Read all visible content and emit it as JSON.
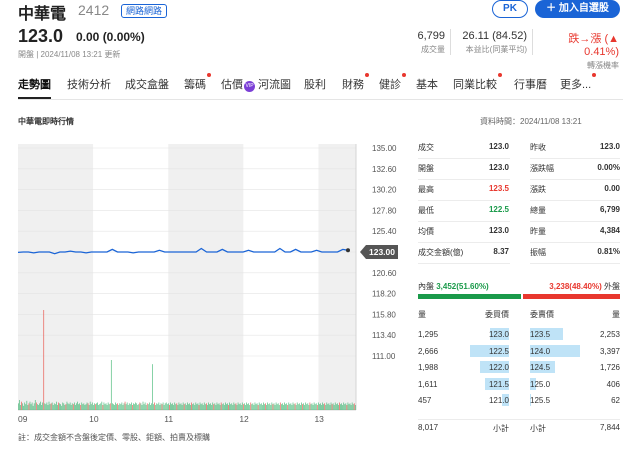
{
  "header": {
    "name": "中華電",
    "code": "2412",
    "tag": "網路網路",
    "price": "123.0",
    "change": "0.00 (0.00%)",
    "status_line": "開盤 | 2024/11/08 13:21 更新",
    "pk_label": "PK",
    "add_label": "加入自選股",
    "stats": [
      {
        "value": "6,799",
        "label": "成交量"
      },
      {
        "value": "26.11 (84.52)",
        "label": "本益比(同業平均)"
      },
      {
        "value": "跌→漲 (▲ 0.41%)",
        "label": "轉漲機率"
      }
    ]
  },
  "tabs": [
    {
      "label": "走勢圖",
      "active": true,
      "dot": false
    },
    {
      "label": "技術分析",
      "dot": false
    },
    {
      "label": "成交盒盤",
      "dot": false
    },
    {
      "label": "籌碼",
      "dot": true
    },
    {
      "label": "估價",
      "dot": false,
      "vip": "VIP"
    },
    {
      "label": "河流圖",
      "dot": false
    },
    {
      "label": "股利",
      "dot": false
    },
    {
      "label": "財務",
      "dot": true
    },
    {
      "label": "健診",
      "dot": true
    },
    {
      "label": "基本",
      "dot": false
    },
    {
      "label": "同業比較",
      "dot": true
    },
    {
      "label": "行事曆",
      "dot": false
    },
    {
      "label": "更多...",
      "dot": true
    }
  ],
  "section_title": "中華電即時行情",
  "data_time": "資料時間：2024/11/08 13:21",
  "chart_data": {
    "type": "line",
    "x_ticks": [
      "09",
      "10",
      "11",
      "12",
      "13"
    ],
    "y_ticks": [
      135.0,
      132.6,
      130.2,
      127.8,
      125.4,
      123.0,
      120.6,
      118.2,
      115.8,
      113.4,
      111.0
    ],
    "y_tick_labels": [
      "135.00",
      "132.60",
      "130.20",
      "127.80",
      "125.40",
      "123.00",
      "120.60",
      "118.20",
      "115.80",
      "113.40",
      "111.00"
    ],
    "ylim": [
      111.0,
      135.0
    ],
    "last_price_label": "123.00",
    "price_series": [
      122.95,
      123.0,
      123.0,
      122.9,
      123.0,
      123.0,
      123.0,
      122.8,
      123.0,
      123.0,
      123.1,
      123.0,
      123.0,
      122.9,
      123.0,
      123.0,
      123.0,
      123.0,
      123.3,
      123.0,
      123.0,
      123.0,
      122.9,
      123.0,
      123.0,
      123.0,
      123.0,
      123.2,
      123.0,
      123.0,
      123.0,
      123.0,
      123.0,
      123.0,
      123.0,
      123.4,
      123.0,
      123.0,
      123.0,
      123.3,
      123.0,
      123.0,
      123.0,
      123.0,
      123.2,
      123.0,
      123.0,
      123.0,
      123.0,
      123.0,
      123.4,
      123.0,
      123.0,
      123.3,
      123.0,
      123.0,
      123.0,
      123.2,
      123.0,
      123.0,
      123.0,
      123.0,
      123.3,
      123.2
    ],
    "volume_series": [
      8,
      12,
      6,
      10,
      8,
      5,
      9,
      7,
      11,
      6,
      8,
      10,
      7,
      9,
      5,
      8,
      12,
      9,
      7,
      6,
      8,
      10,
      6,
      9,
      120,
      8,
      7,
      9,
      6,
      10,
      7,
      8,
      9,
      6,
      8,
      7,
      10,
      6,
      9,
      8,
      7,
      5,
      9,
      8,
      6,
      7,
      10,
      8,
      7,
      9,
      6,
      8,
      7,
      9,
      6,
      8,
      10,
      7,
      8,
      6,
      9,
      7,
      8,
      6,
      7,
      9,
      8,
      6,
      10,
      7,
      9,
      6,
      8,
      7,
      8,
      9,
      6,
      7,
      8,
      10,
      6,
      9,
      7,
      8,
      6,
      9,
      7,
      8,
      60,
      8,
      7,
      6,
      9,
      7,
      8,
      6,
      8,
      7,
      9,
      6,
      8,
      10,
      7,
      9,
      6,
      8,
      7,
      9,
      6,
      8,
      7,
      9,
      8,
      6,
      7,
      9,
      8,
      6,
      10,
      7,
      9,
      6,
      8,
      7,
      9,
      6,
      8,
      55,
      7,
      9,
      6,
      8,
      7,
      9,
      6,
      8,
      7,
      9,
      6,
      8,
      9,
      7,
      8,
      6,
      9,
      7,
      8,
      6,
      9,
      7,
      8,
      6,
      9,
      7,
      8,
      6,
      9,
      7,
      8,
      6,
      9,
      7,
      8,
      6,
      9,
      7,
      8,
      6,
      9,
      7,
      8,
      6,
      9,
      7,
      8,
      6,
      9,
      7,
      8,
      6,
      9,
      7,
      8,
      6,
      9,
      7,
      8,
      6,
      9,
      7,
      8,
      6,
      9,
      7,
      8,
      6,
      9,
      7,
      8,
      6,
      9,
      7,
      8,
      6,
      9,
      7,
      8,
      6,
      9,
      7,
      8,
      6,
      9,
      7,
      8,
      6,
      9,
      7,
      8,
      6,
      9,
      7,
      8,
      6,
      9,
      7,
      8,
      6,
      9,
      7,
      8,
      6,
      9,
      7,
      8,
      6,
      9,
      7,
      8,
      6,
      9,
      7,
      8,
      6,
      9,
      7,
      8,
      6,
      9,
      7,
      8,
      6,
      9,
      7,
      8,
      6,
      9,
      7,
      8,
      6,
      9,
      7,
      8,
      6,
      9,
      7,
      8,
      6,
      9,
      7,
      8,
      6,
      9,
      7,
      8,
      6,
      9,
      7,
      8,
      6,
      9,
      7,
      8,
      6,
      9,
      7,
      8,
      6,
      9,
      7,
      8,
      6,
      9,
      7,
      8,
      6,
      9,
      7,
      8,
      6,
      9,
      7,
      8,
      6,
      9,
      7,
      8,
      6,
      9,
      7,
      8,
      6,
      9,
      7,
      8,
      6,
      9,
      7,
      8,
      6
    ],
    "shaded_hours": [
      "09",
      "11",
      "13"
    ],
    "colors": {
      "line": "#1a64d6",
      "vol_green": "#27ae60",
      "vol_red": "#e8372e",
      "shade": "#f0f0f0"
    }
  },
  "footnote": "註：成交金額不含盤後定價、零股、鉅額、拍賣及標購",
  "summary": {
    "left": [
      {
        "label": "成交",
        "value": "123.0",
        "color": "#333"
      },
      {
        "label": "開盤",
        "value": "123.0",
        "color": "#333"
      },
      {
        "label": "最高",
        "value": "123.5",
        "color": "#e8372e"
      },
      {
        "label": "最低",
        "value": "122.5",
        "color": "#1a9a4a"
      },
      {
        "label": "均價",
        "value": "123.0",
        "color": "#333"
      },
      {
        "label": "成交金額(億)",
        "value": "8.37",
        "color": "#333"
      }
    ],
    "right": [
      {
        "label": "昨收",
        "value": "123.0",
        "color": "#333"
      },
      {
        "label": "漲跌幅",
        "value": "0.00%",
        "color": "#333"
      },
      {
        "label": "漲跌",
        "value": "0.00",
        "color": "#333"
      },
      {
        "label": "總量",
        "value": "6,799",
        "color": "#333"
      },
      {
        "label": "昨量",
        "value": "4,384",
        "color": "#333"
      },
      {
        "label": "振幅",
        "value": "0.81%",
        "color": "#333"
      }
    ]
  },
  "inout": {
    "in_label": "內盤",
    "in_value": "3,452(51.60%)",
    "in_pct": 51.6,
    "out_value": "3,238(48.40%)",
    "out_label": "外盤"
  },
  "orderbook": {
    "headers": [
      "量",
      "委買價",
      "委賣價",
      "量"
    ],
    "rows": [
      {
        "bid_vol": "1,295",
        "bid_vol_n": 1295,
        "bid": "123.0",
        "ask": "123.5",
        "ask_vol": "2,253",
        "ask_vol_n": 2253
      },
      {
        "bid_vol": "2,666",
        "bid_vol_n": 2666,
        "bid": "122.5",
        "ask": "124.0",
        "ask_vol": "3,397",
        "ask_vol_n": 3397
      },
      {
        "bid_vol": "1,988",
        "bid_vol_n": 1988,
        "bid": "122.0",
        "ask": "124.5",
        "ask_vol": "1,726",
        "ask_vol_n": 1726
      },
      {
        "bid_vol": "1,611",
        "bid_vol_n": 1611,
        "bid": "121.5",
        "ask": "125.0",
        "ask_vol": "406",
        "ask_vol_n": 406
      },
      {
        "bid_vol": "457",
        "bid_vol_n": 457,
        "bid": "121.0",
        "ask": "125.5",
        "ask_vol": "62",
        "ask_vol_n": 62
      }
    ],
    "bid_total": "8,017",
    "bid_total_label": "小計",
    "ask_total_label": "小計",
    "ask_total": "7,844"
  }
}
